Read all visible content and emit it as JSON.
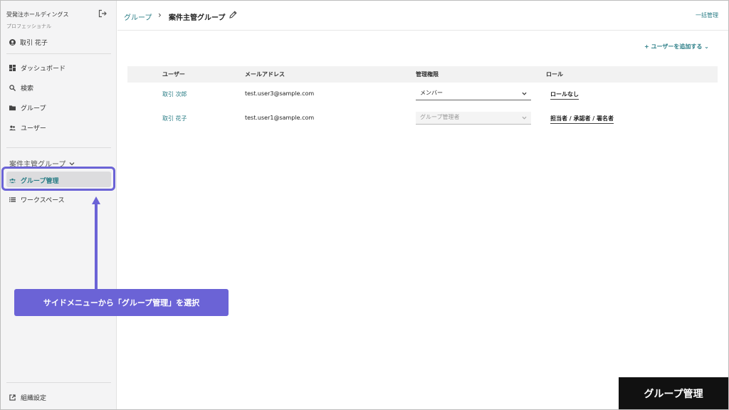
{
  "sidebar": {
    "org_name": "受発注ホールディングス",
    "plan": "プロフェッショナル",
    "user_name": "取引 花子",
    "nav": [
      {
        "label": "ダッシュボード",
        "icon": "dashboard-icon"
      },
      {
        "label": "検索",
        "icon": "search-icon"
      },
      {
        "label": "グループ",
        "icon": "folder-icon"
      },
      {
        "label": "ユーザー",
        "icon": "users-icon"
      }
    ],
    "group_section": "案件主管グループ",
    "active_item": "グループ管理",
    "workspace": "ワークスペース",
    "settings": "組織設定"
  },
  "header": {
    "breadcrumb_link": "グループ",
    "breadcrumb_sep": "›",
    "breadcrumb_current": "案件主管グループ",
    "bulk_manage": "一括管理"
  },
  "main": {
    "add_user": "+ ユーザーを追加する ⌄",
    "columns": [
      "ユーザー",
      "メールアドレス",
      "管理権限",
      "ロール"
    ],
    "rows": [
      {
        "user": "取引 次郎",
        "email": "test.user3@sample.com",
        "permission": "メンバー",
        "role": "ロールなし",
        "disabled": false
      },
      {
        "user": "取引 花子",
        "email": "test.user1@sample.com",
        "permission": "グループ管理者",
        "role": "担当者 / 承認者 / 署名者",
        "disabled": true
      }
    ]
  },
  "annotation": {
    "callout": "サイドメニューから「グループ管理」を選択",
    "caption": "グループ管理",
    "accent_color": "#6b63d6"
  }
}
